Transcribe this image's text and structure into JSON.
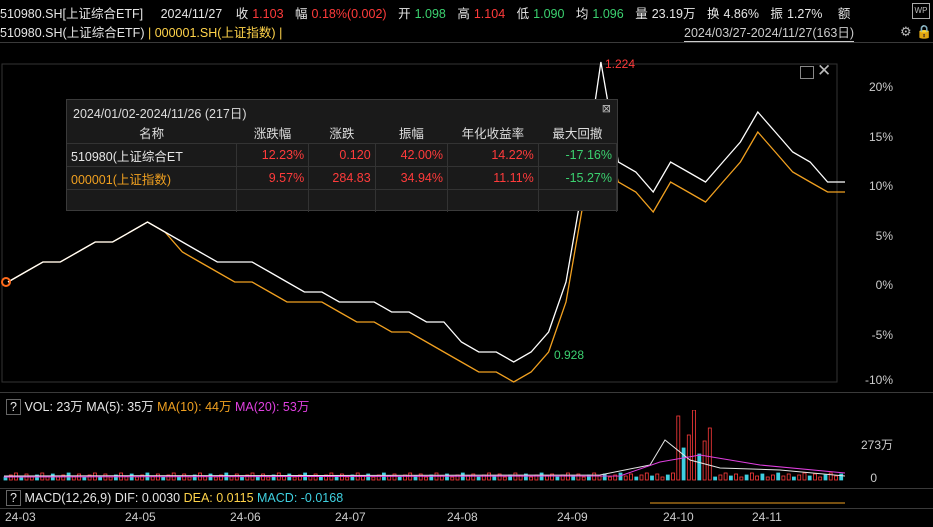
{
  "header": {
    "symbol": "510980.SH[上证综合ETF]",
    "date": "2024/11/27",
    "close_label": "收",
    "close": "1.103",
    "amp_label": "幅",
    "change": "0.18%(0.002)",
    "open_label": "开",
    "open": "1.098",
    "high_label": "高",
    "high": "1.104",
    "low_label": "低",
    "low": "1.090",
    "avg_label": "均",
    "avg": "1.096",
    "vol_label": "量",
    "volume": "23.19万",
    "turn_label": "换",
    "turnover": "4.86%",
    "swing_label": "振",
    "swing": "1.27%",
    "amount_label": "额"
  },
  "compare": {
    "main": "510980.SH(上证综合ETF)",
    "sep": "|",
    "other": "000001.SH(上证指数)",
    "sep2": "|",
    "range": "2024/03/27-2024/11/27(163日)"
  },
  "stats": {
    "title": "2024/01/02-2024/11/26 (217日)",
    "headers": [
      "名称",
      "涨跌幅",
      "涨跌",
      "振幅",
      "年化收益率",
      "最大回撤"
    ],
    "rows": [
      {
        "name": "510980(上证综合ET",
        "pct": "12.23%",
        "chg": "0.120",
        "amp": "42.00%",
        "ann": "14.22%",
        "dd": "-17.16%"
      },
      {
        "name": "000001(上证指数)",
        "pct": "9.57%",
        "chg": "284.83",
        "amp": "34.94%",
        "ann": "11.11%",
        "dd": "-15.27%"
      }
    ]
  },
  "price_axis": [
    "20%",
    "15%",
    "10%",
    "5%",
    "0%",
    "-5%",
    "-10%"
  ],
  "annotations": {
    "high": "1.224",
    "low": "0.928"
  },
  "volume": {
    "label": "VOL: 23万",
    "ma5": "MA(5): 35万",
    "ma10": "MA(10): 44万",
    "ma20": "MA(20): 53万",
    "axis_top": "273万",
    "axis_zero": "0"
  },
  "macd": {
    "label": "MACD(12,26,9)",
    "dif": "DIF: 0.0030",
    "dea": "DEA: 0.0115",
    "macd": "MACD: -0.0168"
  },
  "x_axis": [
    "24-03",
    "24-05",
    "24-06",
    "24-07",
    "24-08",
    "24-09",
    "24-10",
    "24-11"
  ],
  "colors": {
    "up": "#ff3b3b",
    "down": "#3bd16f",
    "etf_line": "#ffffff",
    "index_line": "#f0a020"
  },
  "chart_data": {
    "type": "line",
    "ylabel": "",
    "ylim": [
      -10,
      22
    ],
    "series": [
      {
        "name": "510980.SH(上证综合ETF)",
        "values": [
          0,
          1,
          2,
          2,
          3,
          4,
          4,
          5,
          6,
          5,
          4,
          3,
          2,
          2,
          2,
          1,
          0,
          -1,
          -1,
          -2,
          -2,
          -2,
          -3,
          -3,
          -4,
          -4,
          -6,
          -7,
          -7,
          -8,
          -7,
          -5,
          0,
          10,
          22,
          12,
          11,
          9,
          12,
          11,
          10,
          12,
          14,
          17,
          15,
          13,
          12,
          10,
          10
        ]
      },
      {
        "name": "000001.SH(上证指数)",
        "values": [
          0,
          1,
          2,
          2,
          3,
          4,
          4,
          5,
          6,
          5,
          3,
          2,
          1,
          0,
          0,
          -1,
          -2,
          -2,
          -2,
          -3,
          -4,
          -4,
          -5,
          -5,
          -6,
          -7,
          -8,
          -9,
          -9,
          -10,
          -9,
          -7,
          -2,
          8,
          17,
          10,
          9,
          7,
          10,
          9,
          8,
          10,
          12,
          15,
          13,
          11,
          10,
          9,
          9
        ]
      }
    ]
  }
}
